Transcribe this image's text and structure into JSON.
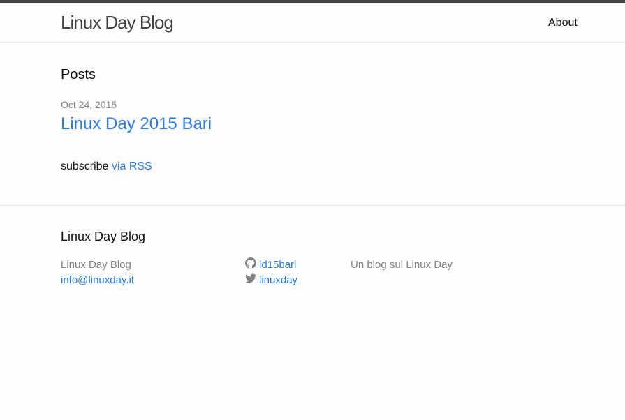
{
  "header": {
    "site_title": "Linux Day Blog",
    "nav": [
      {
        "label": "About"
      }
    ]
  },
  "main": {
    "posts_heading": "Posts",
    "posts": [
      {
        "date": "Oct 24, 2015",
        "title": "Linux Day 2015 Bari"
      }
    ],
    "rss_prefix": "subscribe",
    "rss_link": "via RSS"
  },
  "footer": {
    "heading": "Linux Day Blog",
    "col1_name": "Linux Day Blog",
    "col1_email": "info@linuxday.it",
    "github_icon": "github-icon",
    "github_user": "ld15bari",
    "twitter_icon": "twitter-icon",
    "twitter_user": "linuxday",
    "description": "Un blog sul Linux Day"
  },
  "colors": {
    "accent": "#2a7ae2",
    "top_bar": "#424242",
    "muted": "#828282"
  }
}
